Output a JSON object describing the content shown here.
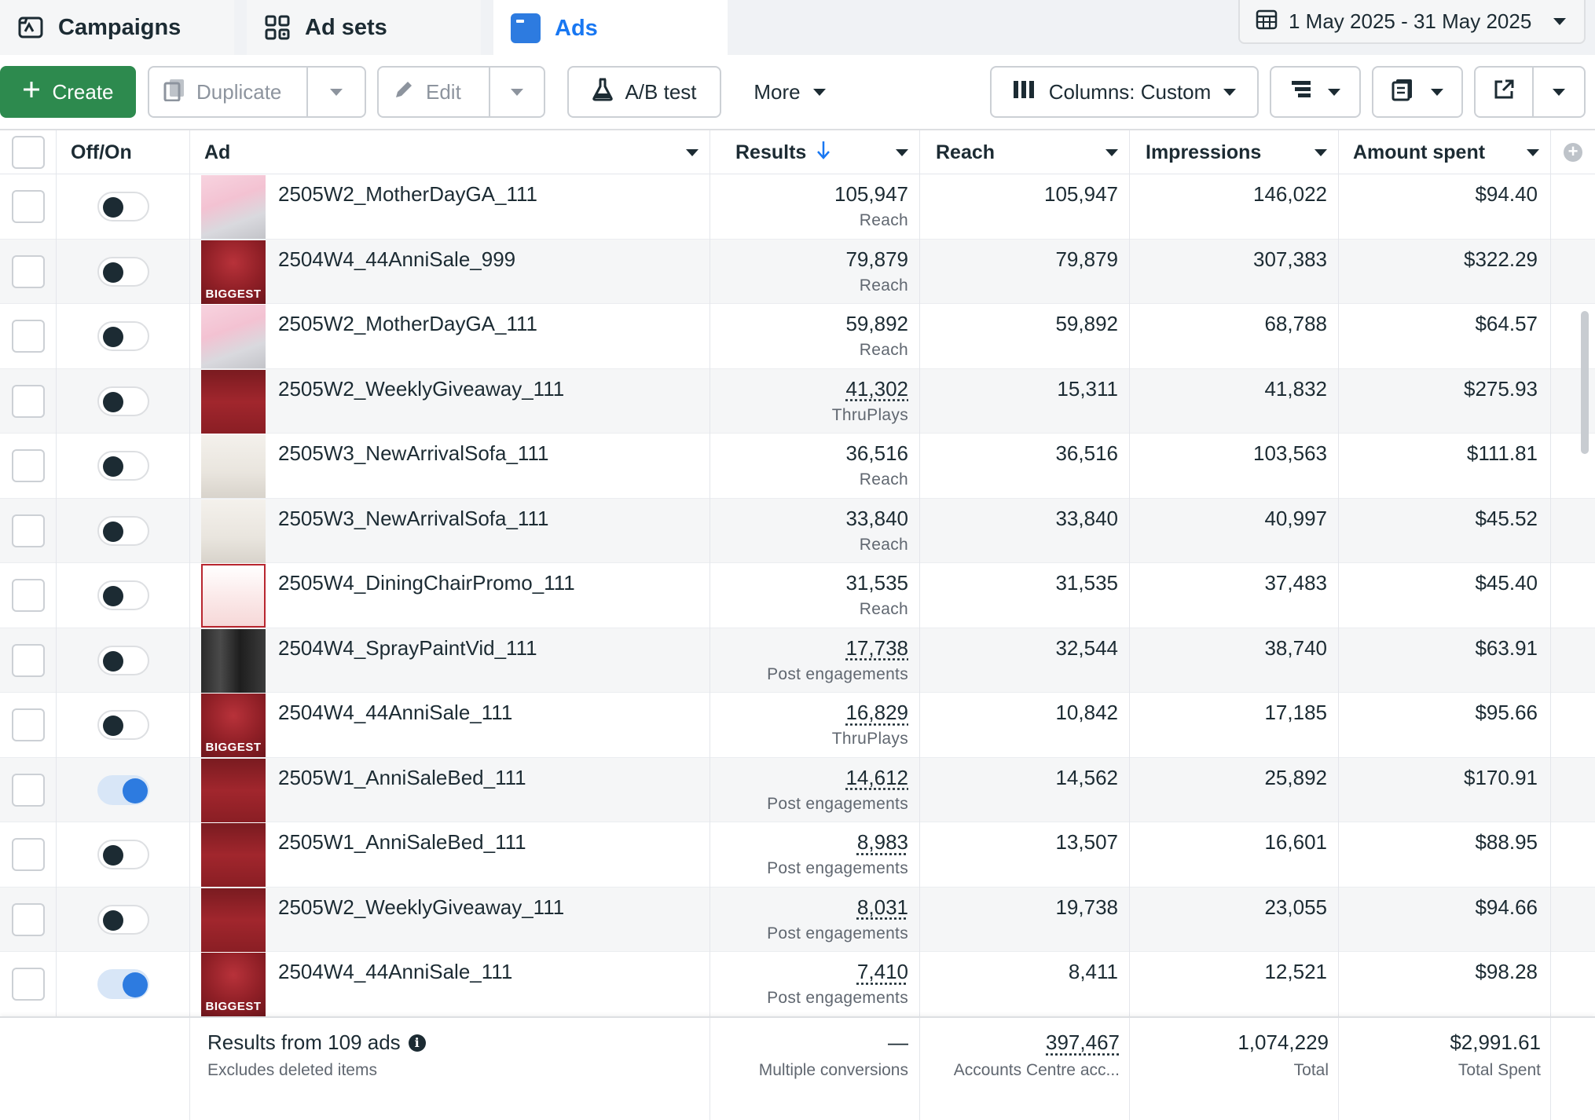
{
  "tabs": [
    {
      "label": "Campaigns",
      "icon": "campaigns-icon"
    },
    {
      "label": "Ad sets",
      "icon": "adsets-grid-icon"
    },
    {
      "label": "Ads",
      "icon": "ads-icon",
      "active": true
    }
  ],
  "date_range": "1 May 2025 - 31 May 2025",
  "toolbar": {
    "create": "Create",
    "duplicate": "Duplicate",
    "edit": "Edit",
    "ab_test": "A/B test",
    "more": "More",
    "columns": "Columns: Custom"
  },
  "columns": {
    "onoff": "Off/On",
    "ad": "Ad",
    "results": "Results",
    "reach": "Reach",
    "impressions": "Impressions",
    "amount_spent": "Amount spent"
  },
  "colors": {
    "accent": "#1877f2",
    "create_green": "#2d8a4e",
    "toggle_on": "#2d7be0"
  },
  "rows": [
    {
      "name": "2505W2_MotherDayGA_111",
      "on": false,
      "results": "105,947",
      "results_type": "Reach",
      "reach": "105,947",
      "impressions": "146,022",
      "amount": "$94.40",
      "thumb": "pink",
      "thumb_text": ""
    },
    {
      "name": "2504W4_44AnniSale_999",
      "on": false,
      "results": "79,879",
      "results_type": "Reach",
      "reach": "79,879",
      "impressions": "307,383",
      "amount": "$322.29",
      "thumb": "maroon",
      "thumb_text": "BIGGEST"
    },
    {
      "name": "2505W2_MotherDayGA_111",
      "on": false,
      "results": "59,892",
      "results_type": "Reach",
      "reach": "59,892",
      "impressions": "68,788",
      "amount": "$64.57",
      "thumb": "pink",
      "thumb_text": ""
    },
    {
      "name": "2505W2_WeeklyGiveaway_111",
      "on": false,
      "results": "41,302",
      "results_type": "ThruPlays",
      "reach": "15,311",
      "impressions": "41,832",
      "amount": "$275.93",
      "thumb": "red",
      "thumb_text": ""
    },
    {
      "name": "2505W3_NewArrivalSofa_111",
      "on": false,
      "results": "36,516",
      "results_type": "Reach",
      "reach": "36,516",
      "impressions": "103,563",
      "amount": "$111.81",
      "thumb": "white",
      "thumb_text": ""
    },
    {
      "name": "2505W3_NewArrivalSofa_111",
      "on": false,
      "results": "33,840",
      "results_type": "Reach",
      "reach": "33,840",
      "impressions": "40,997",
      "amount": "$45.52",
      "thumb": "white",
      "thumb_text": ""
    },
    {
      "name": "2505W4_DiningChairPromo_111",
      "on": false,
      "results": "31,535",
      "results_type": "Reach",
      "reach": "31,535",
      "impressions": "37,483",
      "amount": "$45.40",
      "thumb": "chair",
      "thumb_text": ""
    },
    {
      "name": "2504W4_SprayPaintVid_111",
      "on": false,
      "results": "17,738",
      "results_type": "Post engagements",
      "reach": "32,544",
      "impressions": "38,740",
      "amount": "$63.91",
      "thumb": "dark",
      "thumb_text": ""
    },
    {
      "name": "2504W4_44AnniSale_111",
      "on": false,
      "results": "16,829",
      "results_type": "ThruPlays",
      "reach": "10,842",
      "impressions": "17,185",
      "amount": "$95.66",
      "thumb": "maroon",
      "thumb_text": "BIGGEST"
    },
    {
      "name": "2505W1_AnniSaleBed_111",
      "on": true,
      "results": "14,612",
      "results_type": "Post engagements",
      "reach": "14,562",
      "impressions": "25,892",
      "amount": "$170.91",
      "thumb": "red",
      "thumb_text": ""
    },
    {
      "name": "2505W1_AnniSaleBed_111",
      "on": false,
      "results": "8,983",
      "results_type": "Post engagements",
      "reach": "13,507",
      "impressions": "16,601",
      "amount": "$88.95",
      "thumb": "red",
      "thumb_text": ""
    },
    {
      "name": "2505W2_WeeklyGiveaway_111",
      "on": false,
      "results": "8,031",
      "results_type": "Post engagements",
      "reach": "19,738",
      "impressions": "23,055",
      "amount": "$94.66",
      "thumb": "red",
      "thumb_text": ""
    },
    {
      "name": "2504W4_44AnniSale_111",
      "on": true,
      "results": "7,410",
      "results_type": "Post engagements",
      "reach": "8,411",
      "impressions": "12,521",
      "amount": "$98.28",
      "thumb": "maroon",
      "thumb_text": "BIGGEST"
    }
  ],
  "summary": {
    "title": "Results from 109 ads",
    "subtitle": "Excludes deleted items",
    "results": "—",
    "results_label": "Multiple conversions",
    "reach": "397,467",
    "reach_label": "Accounts Centre acc...",
    "impressions": "1,074,229",
    "impressions_label": "Total",
    "amount": "$2,991.61",
    "amount_label": "Total Spent"
  }
}
